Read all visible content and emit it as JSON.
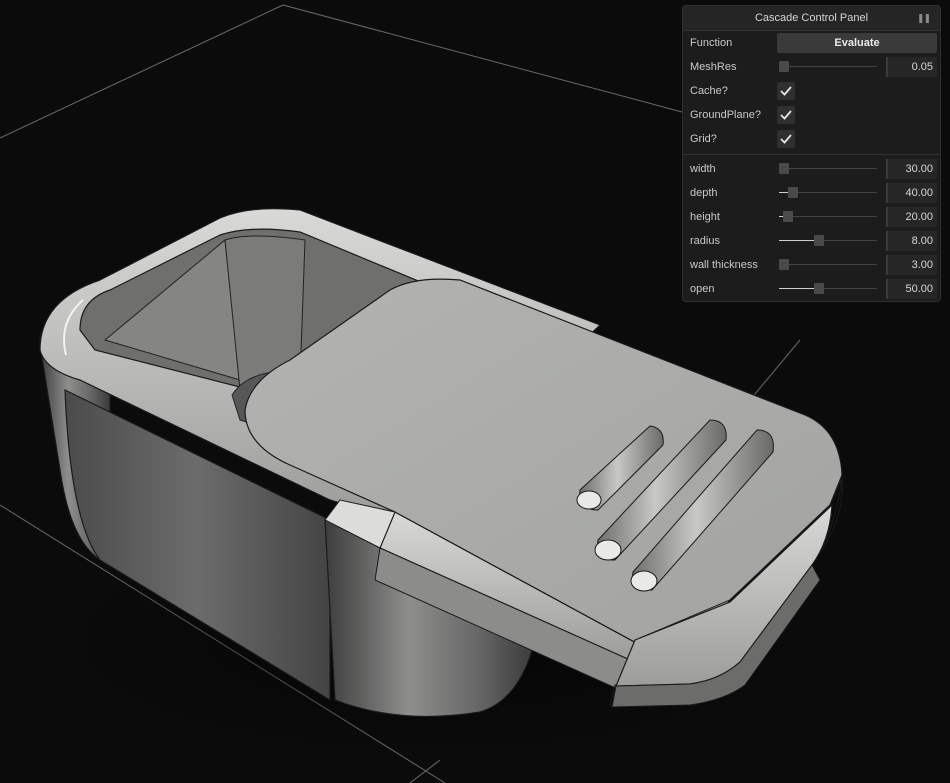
{
  "panel": {
    "title": "Cascade Control Panel",
    "grip_icon": "drag-handle-icon",
    "function_label": "Function",
    "evaluate_label": "Evaluate",
    "meshres": {
      "label": "MeshRes",
      "value": "0.05",
      "fraction": 0.0
    },
    "toggles": [
      {
        "label": "Cache?",
        "checked": true
      },
      {
        "label": "GroundPlane?",
        "checked": true
      },
      {
        "label": "Grid?",
        "checked": true
      }
    ],
    "params": [
      {
        "label": "width",
        "value": "30.00",
        "fraction": 0.0
      },
      {
        "label": "depth",
        "value": "40.00",
        "fraction": 0.1
      },
      {
        "label": "height",
        "value": "20.00",
        "fraction": 0.05
      },
      {
        "label": "radius",
        "value": "8.00",
        "fraction": 0.4
      },
      {
        "label": "wall thickness",
        "value": "3.00",
        "fraction": 0.0
      },
      {
        "label": "open",
        "value": "50.00",
        "fraction": 0.4
      }
    ]
  },
  "colors": {
    "background": "#0b0b0b",
    "panel": "#1c1c1c",
    "model_light": "#b8b9b7",
    "model_dark": "#5a5b5a",
    "grid_line": "#6a6a6a"
  }
}
